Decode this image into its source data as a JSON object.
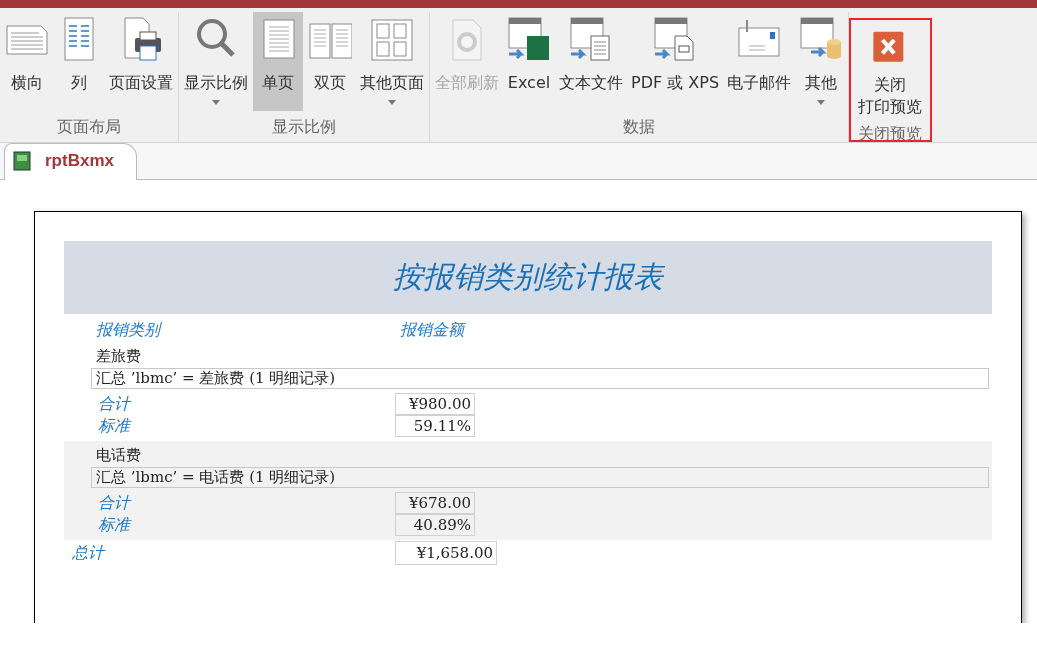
{
  "ribbon": {
    "groups": [
      {
        "label": "页面布局",
        "highlighted": false,
        "buttons": [
          {
            "label": "横向",
            "has_menu": false,
            "selected": false,
            "disabled": false
          },
          {
            "label": "列",
            "has_menu": false,
            "selected": false,
            "disabled": false
          },
          {
            "label": "页面设置",
            "has_menu": false,
            "selected": false,
            "disabled": false
          }
        ]
      },
      {
        "label": "显示比例",
        "highlighted": false,
        "buttons": [
          {
            "label": "显示比例",
            "has_menu": true,
            "selected": false,
            "disabled": false
          },
          {
            "label": "单页",
            "has_menu": false,
            "selected": true,
            "disabled": false
          },
          {
            "label": "双页",
            "has_menu": false,
            "selected": false,
            "disabled": false
          },
          {
            "label": "其他页面",
            "has_menu": true,
            "selected": false,
            "disabled": false
          }
        ]
      },
      {
        "label": "数据",
        "highlighted": false,
        "buttons": [
          {
            "label": "全部刷新",
            "has_menu": false,
            "selected": false,
            "disabled": true
          },
          {
            "label": "Excel",
            "has_menu": false,
            "selected": false,
            "disabled": false
          },
          {
            "label": "文本文件",
            "has_menu": false,
            "selected": false,
            "disabled": false
          },
          {
            "label": "PDF 或 XPS",
            "has_menu": false,
            "selected": false,
            "disabled": false
          },
          {
            "label": "电子邮件",
            "has_menu": false,
            "selected": false,
            "disabled": false
          },
          {
            "label": "其他",
            "has_menu": true,
            "selected": false,
            "disabled": false
          }
        ]
      },
      {
        "label": "关闭预览",
        "highlighted": true,
        "buttons": [
          {
            "label": "关闭",
            "label_2": "打印预览",
            "has_menu": false,
            "selected": false,
            "disabled": false
          }
        ]
      }
    ]
  },
  "tab": {
    "label": "rptBxmx"
  },
  "report": {
    "title": "按报销类别统计报表",
    "columns": [
      "报销类别",
      "报销金额"
    ],
    "groups": [
      {
        "name": "差旅费",
        "shaded": false,
        "summary": "汇总 ’lbmc’ =  差旅费 (1 明细记录)",
        "rows": [
          {
            "label": "合计",
            "value": "¥980.00"
          },
          {
            "label": "标准",
            "value": "59.11%"
          }
        ]
      },
      {
        "name": "电话费",
        "shaded": true,
        "summary": "汇总 ’lbmc’ =  电话费 (1 明细记录)",
        "rows": [
          {
            "label": "合计",
            "value": "¥678.00"
          },
          {
            "label": "标准",
            "value": "40.89%"
          }
        ]
      }
    ],
    "total": {
      "label": "总计",
      "value": "¥1,658.00"
    }
  }
}
